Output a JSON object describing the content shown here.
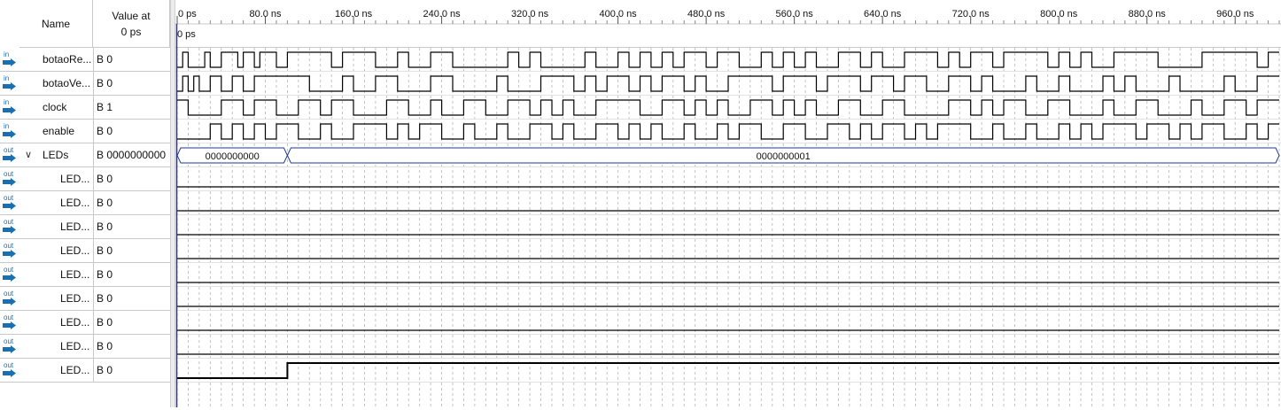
{
  "header": {
    "name_label": "Name",
    "value_label_line1": "Value at",
    "value_label_line2": "0 ps",
    "cursor_label": "0 ps"
  },
  "timeline": {
    "ticks": [
      "0 ps",
      "80.0 ns",
      "160.0 ns",
      "240.0 ns",
      "320.0 ns",
      "400.0 ns",
      "480.0 ns",
      "560.0 ns",
      "640.0 ns",
      "720.0 ns",
      "800.0 ns",
      "880.0 ns",
      "960.0 ns"
    ],
    "tick_ns": [
      0,
      80,
      160,
      240,
      320,
      400,
      480,
      560,
      640,
      720,
      800,
      880,
      960
    ],
    "range_ns": [
      0,
      1000
    ],
    "grid": true
  },
  "colors": {
    "wave": "#000000",
    "bus": "#1f3a93",
    "cursor": "#2b2bbf",
    "grid": "#b5b5b5",
    "in_icon": "#1a6fb0",
    "out_icon": "#1a6fb0"
  },
  "signals": [
    {
      "icon": "input-icon",
      "dir": "in",
      "name": "botaoRe...",
      "value": "B 0",
      "type": "bit",
      "edges": [
        0,
        5,
        10,
        25,
        30,
        40,
        55,
        60,
        70,
        75,
        90,
        100,
        140,
        150,
        180,
        200,
        210,
        230,
        250,
        300,
        310,
        320,
        330,
        370,
        380,
        400,
        410,
        420,
        430,
        440,
        450,
        460,
        480,
        490,
        510,
        530,
        540,
        550,
        560,
        570,
        580,
        600,
        620,
        630,
        640,
        660,
        690,
        700,
        710,
        720,
        740,
        750,
        790,
        800,
        810,
        820,
        830,
        850,
        890,
        930,
        980,
        990,
        1000
      ],
      "init": 0
    },
    {
      "icon": "input-icon",
      "dir": "in",
      "name": "botaoVe...",
      "value": "B 0",
      "type": "bit",
      "edges": [
        0,
        5,
        10,
        15,
        20,
        30,
        40,
        50,
        60,
        70,
        120,
        150,
        160,
        180,
        200,
        230,
        250,
        290,
        300,
        330,
        360,
        370,
        380,
        390,
        410,
        420,
        430,
        440,
        460,
        470,
        480,
        500,
        540,
        550,
        580,
        590,
        620,
        630,
        650,
        660,
        680,
        700,
        720,
        730,
        740,
        770,
        780,
        800,
        810,
        840,
        850,
        860,
        870,
        900,
        910,
        950,
        960,
        980,
        1000
      ],
      "init": 0
    },
    {
      "icon": "input-icon",
      "dir": "in",
      "name": "clock",
      "value": "B 1",
      "type": "bit",
      "edges": [
        0,
        10,
        40,
        60,
        70,
        90,
        110,
        130,
        140,
        160,
        190,
        210,
        230,
        240,
        260,
        280,
        300,
        320,
        330,
        340,
        350,
        360,
        380,
        420,
        440,
        460,
        470,
        480,
        490,
        500,
        520,
        540,
        550,
        560,
        570,
        580,
        600,
        620,
        640,
        660,
        700,
        720,
        730,
        740,
        750,
        770,
        790,
        810,
        840,
        850,
        870,
        890,
        920,
        930,
        950,
        970,
        980,
        1000
      ],
      "init": 1
    },
    {
      "icon": "input-icon",
      "dir": "in",
      "name": "enable",
      "value": "B 0",
      "type": "bit",
      "edges": [
        0,
        30,
        40,
        50,
        60,
        70,
        80,
        90,
        110,
        130,
        140,
        160,
        190,
        200,
        210,
        220,
        240,
        260,
        270,
        290,
        300,
        320,
        340,
        350,
        360,
        380,
        400,
        410,
        420,
        430,
        440,
        460,
        470,
        490,
        500,
        510,
        530,
        550,
        570,
        590,
        610,
        620,
        630,
        640,
        660,
        670,
        680,
        690,
        720,
        740,
        750,
        770,
        780,
        800,
        810,
        820,
        830,
        840,
        870,
        880,
        900,
        910,
        920,
        930,
        950,
        970,
        980,
        990,
        1000
      ],
      "init": 0
    },
    {
      "icon": "output-icon",
      "dir": "out",
      "name": "LEDs",
      "value": "B 0000000000",
      "type": "bus",
      "expanded": true,
      "segments": [
        {
          "start": 0,
          "end": 100,
          "label": "0000000000"
        },
        {
          "start": 100,
          "end": 1000,
          "label": "0000000001"
        }
      ]
    },
    {
      "icon": "output-icon",
      "dir": "out",
      "name": "LED...",
      "value": "B 0",
      "type": "bit",
      "edges": [],
      "init": 0,
      "child": true
    },
    {
      "icon": "output-icon",
      "dir": "out",
      "name": "LED...",
      "value": "B 0",
      "type": "bit",
      "edges": [],
      "init": 0,
      "child": true
    },
    {
      "icon": "output-icon",
      "dir": "out",
      "name": "LED...",
      "value": "B 0",
      "type": "bit",
      "edges": [],
      "init": 0,
      "child": true
    },
    {
      "icon": "output-icon",
      "dir": "out",
      "name": "LED...",
      "value": "B 0",
      "type": "bit",
      "edges": [],
      "init": 0,
      "child": true
    },
    {
      "icon": "output-icon",
      "dir": "out",
      "name": "LED...",
      "value": "B 0",
      "type": "bit",
      "edges": [],
      "init": 0,
      "child": true
    },
    {
      "icon": "output-icon",
      "dir": "out",
      "name": "LED...",
      "value": "B 0",
      "type": "bit",
      "edges": [],
      "init": 0,
      "child": true
    },
    {
      "icon": "output-icon",
      "dir": "out",
      "name": "LED...",
      "value": "B 0",
      "type": "bit",
      "edges": [],
      "init": 0,
      "child": true
    },
    {
      "icon": "output-icon",
      "dir": "out",
      "name": "LED...",
      "value": "B 0",
      "type": "bit",
      "edges": [],
      "init": 0,
      "child": true
    },
    {
      "icon": "output-icon",
      "dir": "out",
      "name": "LED...",
      "value": "B 0",
      "type": "bit",
      "edges": [
        100
      ],
      "init": 0,
      "child": true
    }
  ]
}
